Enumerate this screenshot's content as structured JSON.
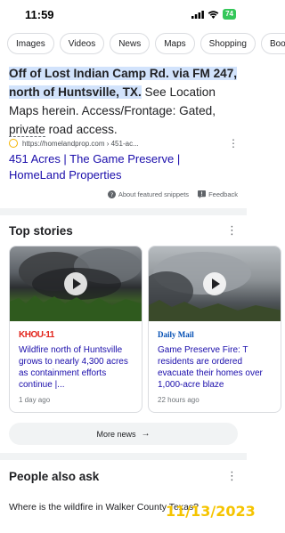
{
  "status_bar": {
    "time": "11:59",
    "battery": "74"
  },
  "chips": [
    "Images",
    "Videos",
    "News",
    "Maps",
    "Shopping",
    "Boo"
  ],
  "snippet": {
    "highlight_1": "Off of Lost Indian Camp Rd. via FM 247,",
    "highlight_2": "north of Huntsville, TX.",
    "text_1": " See Location Maps herein. Access/Frontage: Gated, ",
    "dotted_text": "private",
    "text_2": " road access."
  },
  "source": {
    "url": "https://homelandprop.com › 451-ac..."
  },
  "result_title": "451 Acres | The Game Preserve | HomeLand Properties",
  "about_snippets": "About featured snippets",
  "feedback": "Feedback",
  "top_stories": {
    "title": "Top stories",
    "cards": [
      {
        "source": "KHOU-11",
        "headline": "Wildfire north of Huntsville grows to nearly 4,300 acres as containment efforts continue |...",
        "time": "1 day ago"
      },
      {
        "source": "Daily Mail",
        "headline": "Game Preserve Fire: T residents are ordered evacuate their homes over 1,000-acre blaze",
        "time": "22 hours ago"
      }
    ],
    "more_news": "More news"
  },
  "people_also_ask": {
    "title": "People also ask",
    "question": "Where is the wildfire in Walker County Texas?"
  },
  "watermark": "11/13/2023",
  "colors": {
    "link": "#1a0dab",
    "highlight": "#d2e3fc",
    "khou": "#e2231a",
    "watermark": "#f5c400"
  }
}
